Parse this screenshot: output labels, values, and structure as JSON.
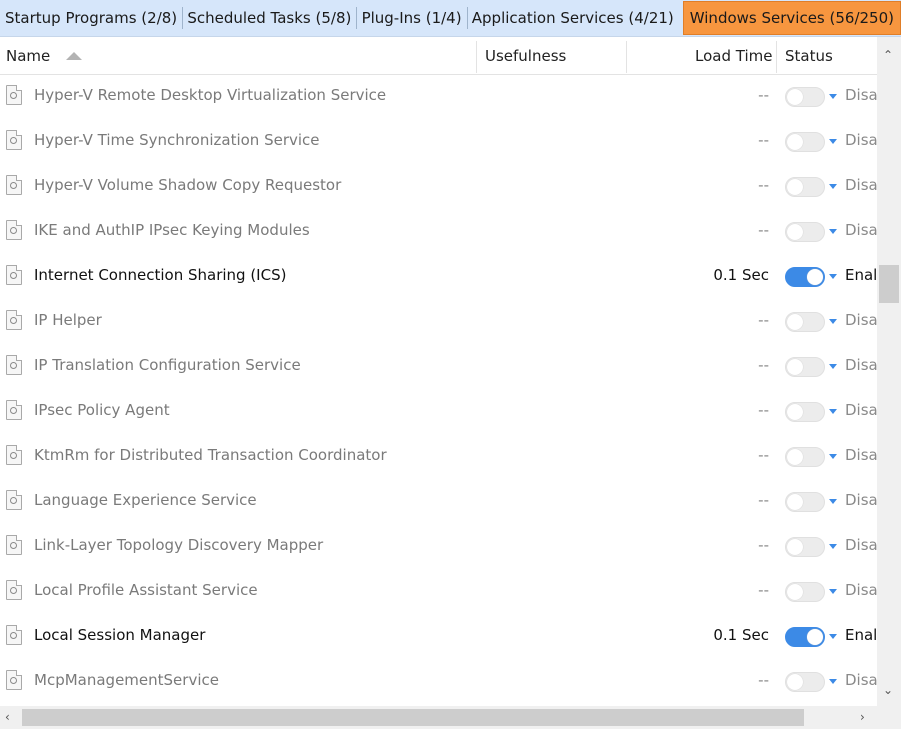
{
  "tabs": [
    {
      "label": "Startup Programs (2/8)"
    },
    {
      "label": "Scheduled Tasks (5/8)"
    },
    {
      "label": "Plug-Ins (1/4)"
    },
    {
      "label": "Application Services (4/21)"
    },
    {
      "label": "Windows Services (56/250)",
      "active": true
    }
  ],
  "columns": {
    "name": "Name",
    "usefulness": "Usefulness",
    "load_time": "Load Time",
    "status": "Status"
  },
  "rows": [
    {
      "name": "Hyper-V Remote Desktop Virtualization Service",
      "load_time": "--",
      "enabled": false,
      "status": "Disa"
    },
    {
      "name": "Hyper-V Time Synchronization Service",
      "load_time": "--",
      "enabled": false,
      "status": "Disa"
    },
    {
      "name": "Hyper-V Volume Shadow Copy Requestor",
      "load_time": "--",
      "enabled": false,
      "status": "Disa"
    },
    {
      "name": "IKE and AuthIP IPsec Keying Modules",
      "load_time": "--",
      "enabled": false,
      "status": "Disa"
    },
    {
      "name": "Internet Connection Sharing (ICS)",
      "load_time": "0.1 Sec",
      "enabled": true,
      "status": "Enal"
    },
    {
      "name": "IP Helper",
      "load_time": "--",
      "enabled": false,
      "status": "Disa"
    },
    {
      "name": "IP Translation Configuration Service",
      "load_time": "--",
      "enabled": false,
      "status": "Disa"
    },
    {
      "name": "IPsec Policy Agent",
      "load_time": "--",
      "enabled": false,
      "status": "Disa"
    },
    {
      "name": "KtmRm for Distributed Transaction Coordinator",
      "load_time": "--",
      "enabled": false,
      "status": "Disa"
    },
    {
      "name": "Language Experience Service",
      "load_time": "--",
      "enabled": false,
      "status": "Disa"
    },
    {
      "name": "Link-Layer Topology Discovery Mapper",
      "load_time": "--",
      "enabled": false,
      "status": "Disa"
    },
    {
      "name": "Local Profile Assistant Service",
      "load_time": "--",
      "enabled": false,
      "status": "Disa"
    },
    {
      "name": "Local Session Manager",
      "load_time": "0.1 Sec",
      "enabled": true,
      "status": "Enal"
    },
    {
      "name": "McpManagementService",
      "load_time": "--",
      "enabled": false,
      "status": "Disa"
    }
  ],
  "colors": {
    "tab_bar_bg": "#d6e6fa",
    "active_tab_bg": "#f7963f",
    "toggle_on": "#3c8ae6",
    "toggle_off": "#ececec"
  },
  "icons": {
    "row_icon": "service-page-icon",
    "sort": "sort-ascending-icon",
    "dropdown": "chevron-down-icon"
  }
}
